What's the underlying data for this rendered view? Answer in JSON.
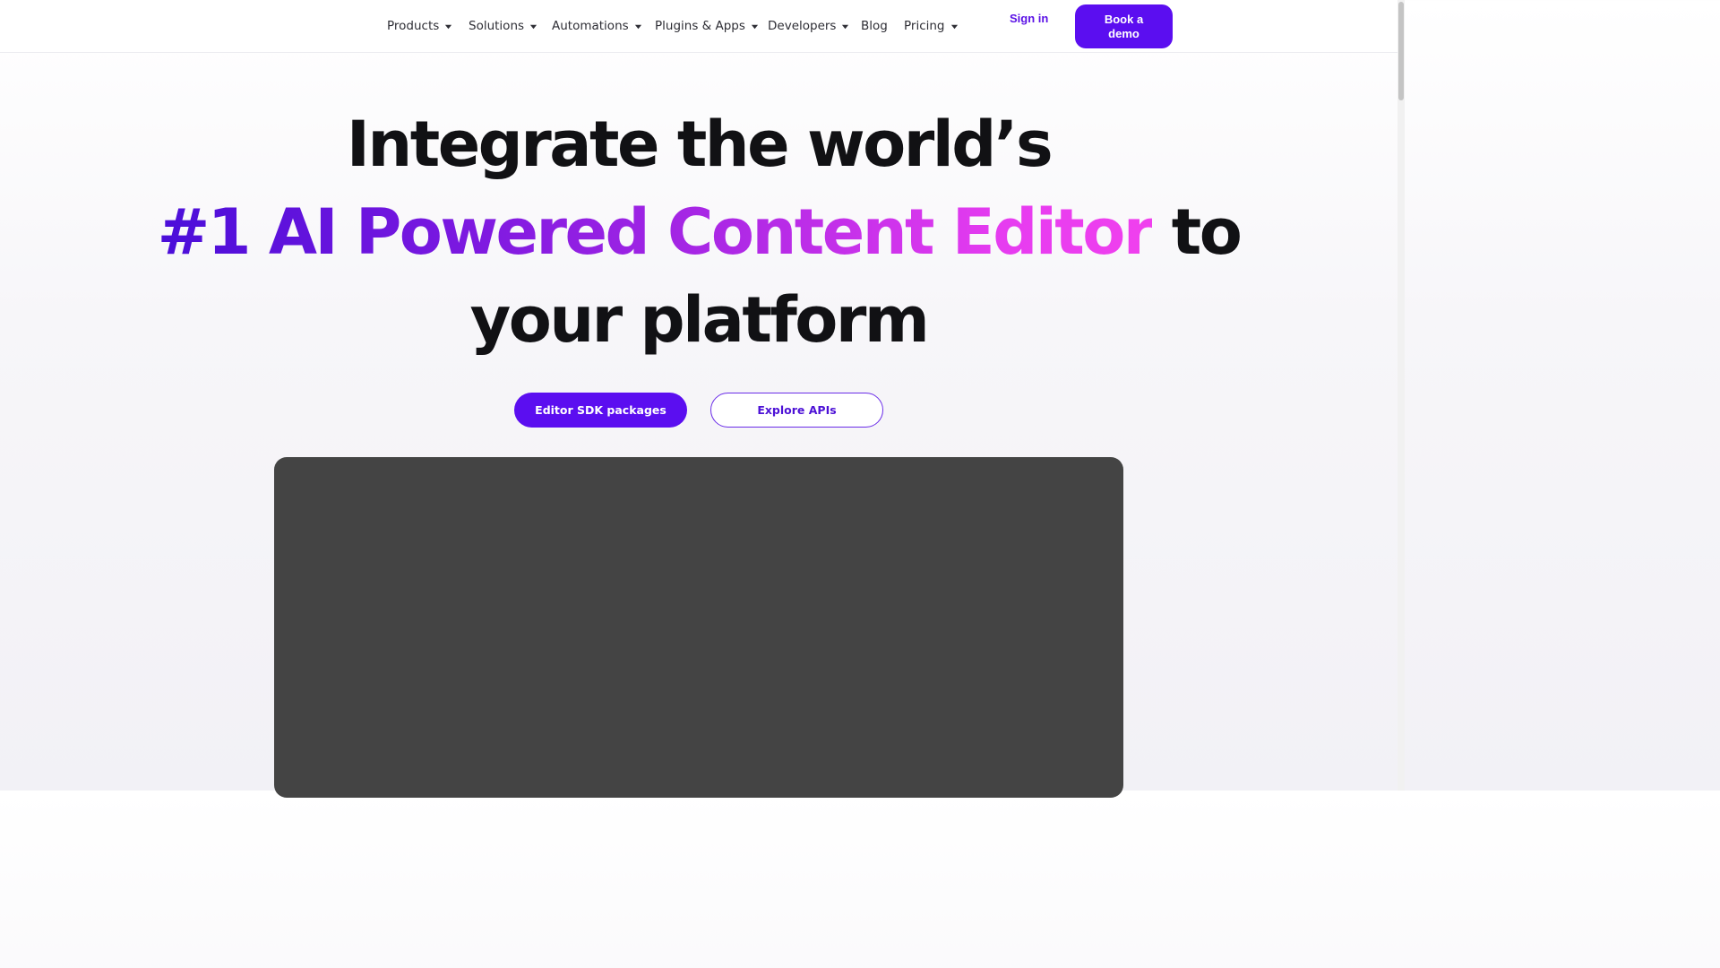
{
  "nav": {
    "items": [
      {
        "label": "Products",
        "caret": true
      },
      {
        "label": "Solutions",
        "caret": true
      },
      {
        "label": "Automations",
        "caret": true
      },
      {
        "label": "Plugins & Apps",
        "caret": true
      },
      {
        "label": "Developers",
        "caret": true
      },
      {
        "label": "Blog",
        "caret": false
      },
      {
        "label": "Pricing",
        "caret": true
      }
    ],
    "sign_in": "Sign in",
    "book_demo": "Book a demo"
  },
  "hero": {
    "line1": "Integrate the world’s",
    "line2_highlight": "#1 AI Powered Content Editor",
    "line2_rest": " to",
    "line3": "your platform",
    "primary_cta": "Editor SDK packages",
    "secondary_cta": "Explore APIs"
  },
  "colors": {
    "accent": "#5b0ef0",
    "gradient_start": "#4a0ed9",
    "gradient_end": "#f040ee",
    "video_panel": "#444444"
  }
}
